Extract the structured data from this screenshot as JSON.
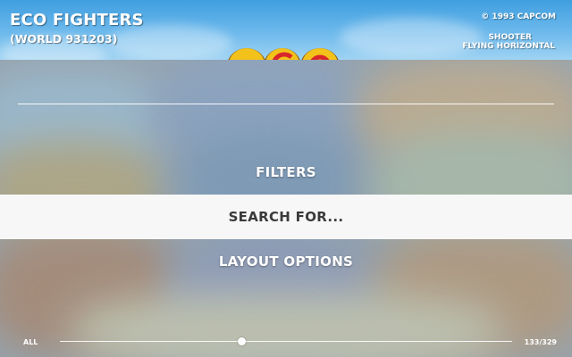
{
  "game": {
    "title": "ECO FIGHTERS",
    "version": "(WORLD 931203)",
    "copyright": "© 1993 CAPCOM",
    "genre": "SHOOTER",
    "subgenre": "FLYING HORIZONTAL"
  },
  "menu": {
    "items": [
      {
        "label": "FILTERS",
        "selected": false
      },
      {
        "label": "SEARCH FOR...",
        "selected": true
      },
      {
        "label": "LAYOUT OPTIONS",
        "selected": false
      }
    ]
  },
  "footer": {
    "filter_label": "ALL",
    "position_text": "133/329",
    "position_current": 133,
    "position_total": 329
  },
  "colors": {
    "selected_row": "#f7f7f7",
    "selected_text": "#3a3a3a",
    "menu_text": "#ffffff",
    "logo_yellow": "#f2c21b",
    "logo_red": "#d8262b"
  }
}
